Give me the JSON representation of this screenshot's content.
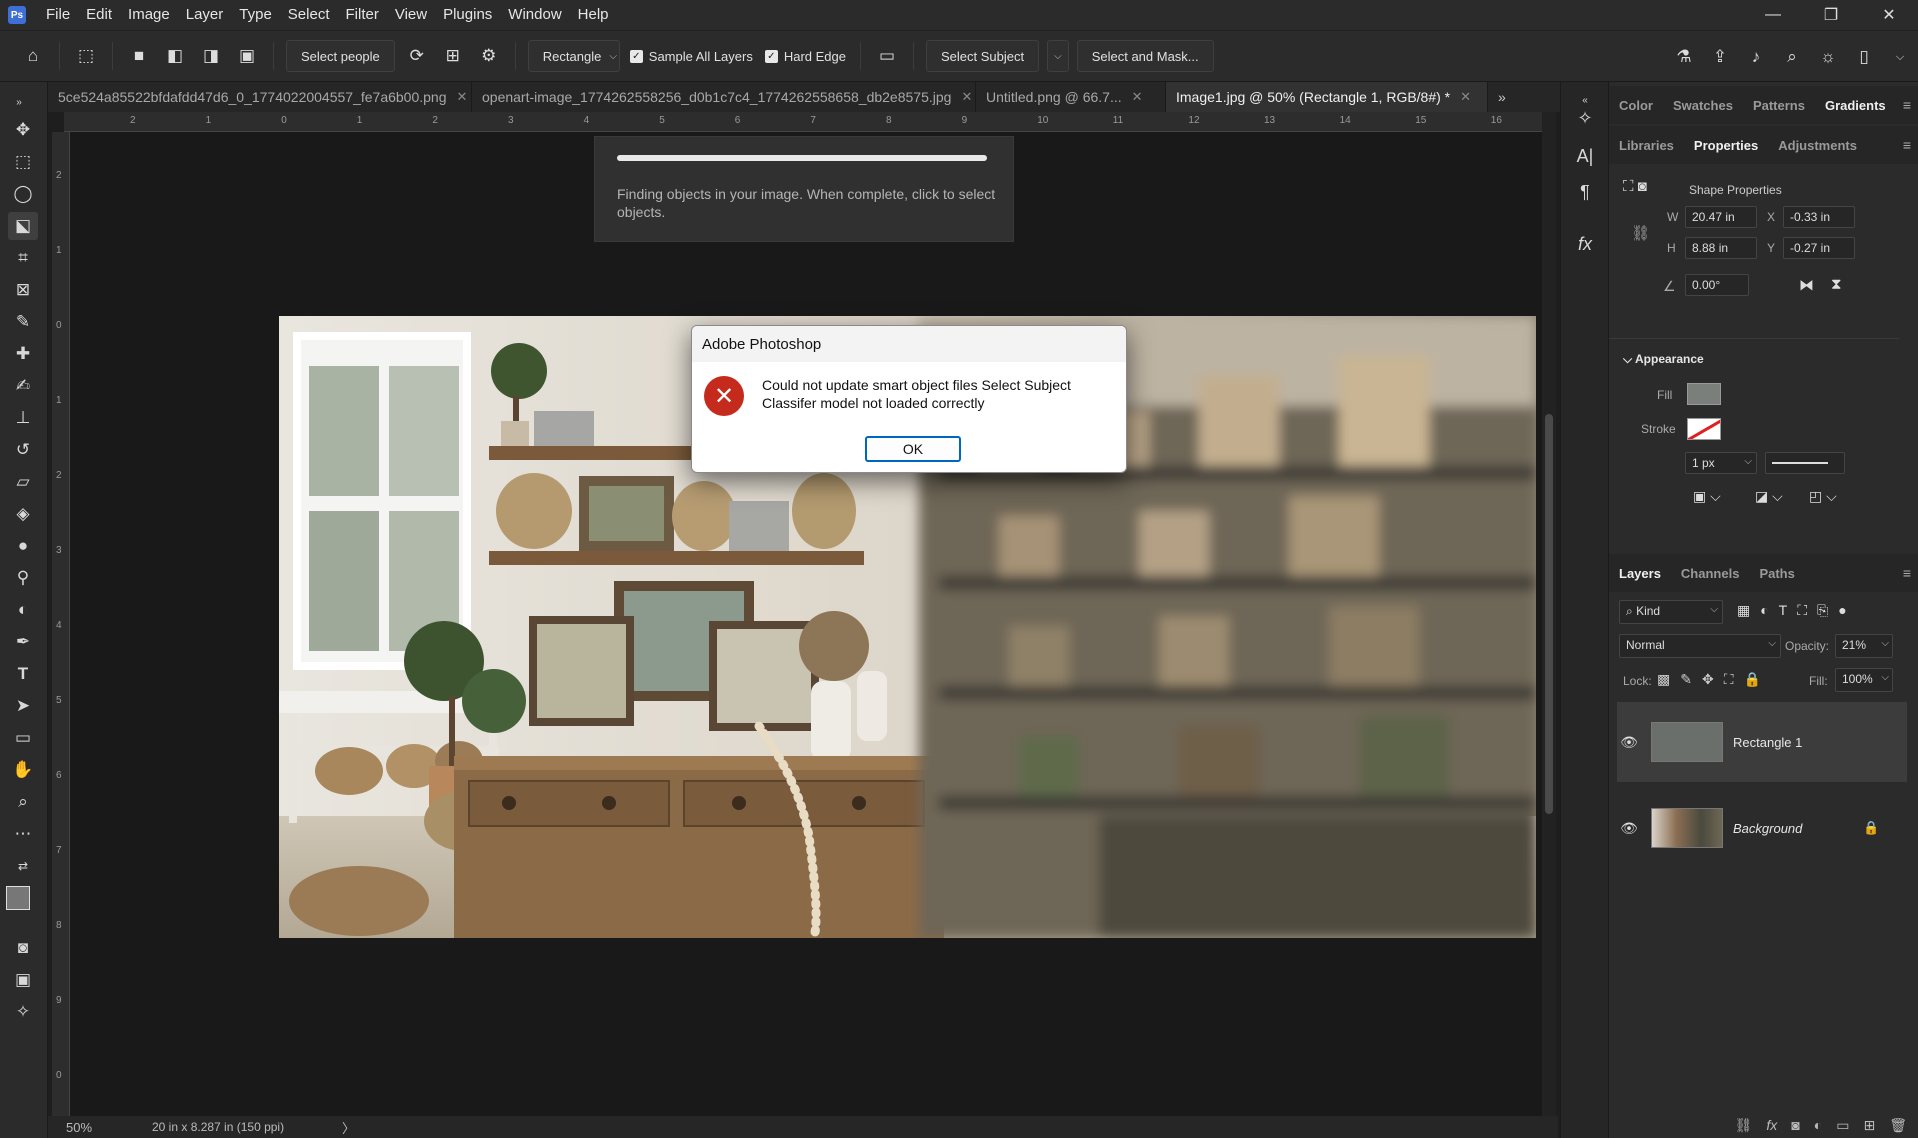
{
  "menu": {
    "items": [
      "File",
      "Edit",
      "Image",
      "Layer",
      "Type",
      "Select",
      "Filter",
      "View",
      "Plugins",
      "Window",
      "Help"
    ],
    "logo": "Ps"
  },
  "window_controls": {
    "minimize": "—",
    "restore": "❐",
    "close": "✕"
  },
  "options_bar": {
    "select_people": "Select people",
    "mode": "Rectangle",
    "sample_all_layers": "Sample All Layers",
    "hard_edge": "Hard Edge",
    "select_subject": "Select Subject",
    "select_and_mask": "Select and Mask..."
  },
  "tabs": [
    {
      "label": "5ce524a85522bfdafdd47d6_0_1774022004557_fe7a6b00.png",
      "close": "✕"
    },
    {
      "label": "openart-image_1774262558256_d0b1c7c4_1774262558658_db2e8575.jpg",
      "close": "✕"
    },
    {
      "label": "Untitled.png @ 66.7...",
      "close": "✕"
    },
    {
      "label": "Image1.jpg @ 50% (Rectangle 1, RGB/8#) *",
      "close": "✕"
    }
  ],
  "ruler": {
    "h_labels": [
      "2",
      "1",
      "0",
      "1",
      "2",
      "3",
      "4",
      "5",
      "6",
      "7",
      "8",
      "9",
      "10",
      "11",
      "12",
      "13",
      "14",
      "15",
      "16"
    ],
    "v_labels": [
      "2",
      "1",
      "0",
      "1",
      "2",
      "3",
      "4",
      "5",
      "6",
      "7",
      "8",
      "9",
      "0"
    ]
  },
  "progress": {
    "fraction": 1.0,
    "message": "Finding objects in your image. When complete, click to select objects."
  },
  "dialog": {
    "title": "Adobe Photoshop",
    "message": "Could not update smart object files Select Subject Classifer model not loaded correctly",
    "ok": "OK"
  },
  "status": {
    "zoom": "50%",
    "doc_size": "20 in x 8.287 in (150 ppi)",
    "arrow": "〉"
  },
  "panels": {
    "top_tabs": [
      "Color",
      "Swatches",
      "Patterns",
      "Gradients"
    ],
    "top_active": "Gradients",
    "mid_tabs": [
      "Libraries",
      "Properties",
      "Adjustments"
    ],
    "mid_active": "Properties",
    "shape_properties": "Shape Properties",
    "w_label": "W",
    "w_value": "20.47 in",
    "x_label": "X",
    "x_value": "-0.33 in",
    "h_label": "H",
    "h_value": "8.88 in",
    "y_label": "Y",
    "y_value": "-0.27 in",
    "angle": "0.00°",
    "appearance": "Appearance",
    "fill_label": "Fill",
    "stroke_label": "Stroke",
    "stroke_width": "1 px",
    "fill_color": "#7b7f7b"
  },
  "layers": {
    "tabs": [
      "Layers",
      "Channels",
      "Paths"
    ],
    "active_tab": "Layers",
    "kind": "Kind",
    "blend": "Normal",
    "opacity_label": "Opacity:",
    "opacity": "21%",
    "lock_label": "Lock:",
    "fill_label": "Fill:",
    "fill": "100%",
    "items": [
      {
        "name": "Rectangle 1",
        "selected": true
      },
      {
        "name": "Background",
        "selected": false
      }
    ]
  }
}
